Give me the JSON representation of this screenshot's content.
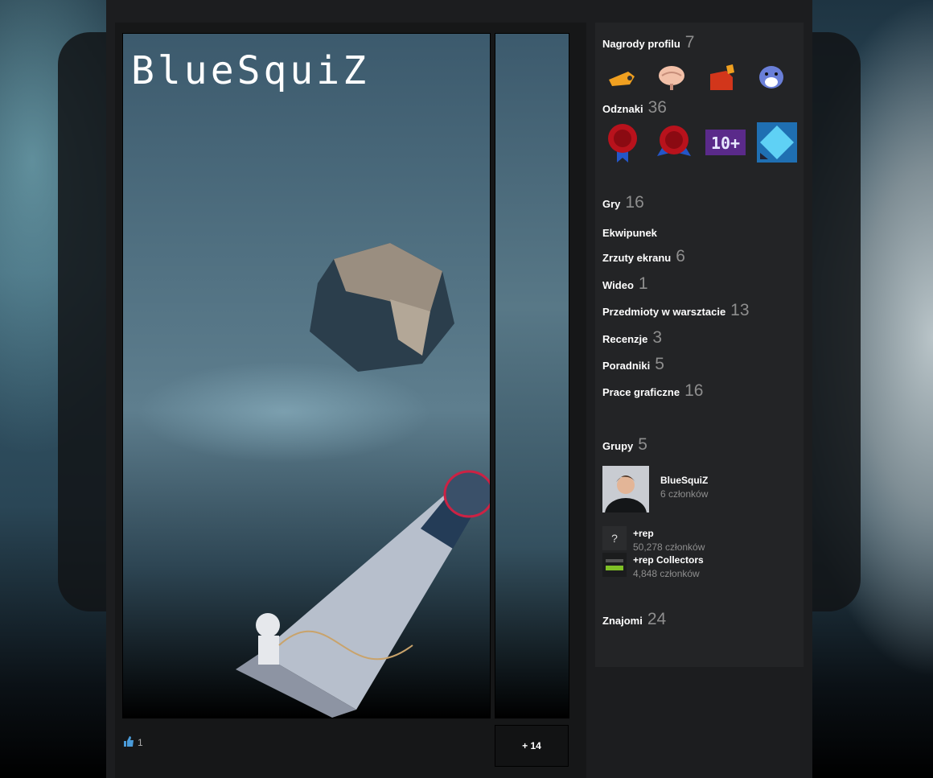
{
  "showcase": {
    "title": "BlueSquiZ",
    "likes": "1",
    "more_label": "+ 14"
  },
  "rewards": {
    "label": "Nagrody profilu",
    "count": "7",
    "icons": [
      "whistle-icon",
      "brain-icon",
      "fuel-can-icon",
      "leopard-icon"
    ]
  },
  "badges": {
    "label": "Odznaki",
    "count": "36",
    "icons": [
      "wax-seal-badge-icon",
      "wax-seal-badge-icon",
      "ten-plus-badge-icon",
      "crystal-badge-icon"
    ],
    "ten_plus_text": "10+"
  },
  "links": [
    {
      "label": "Gry",
      "count": "16"
    },
    {
      "label": "Ekwipunek",
      "count": ""
    },
    {
      "label": "Zrzuty ekranu",
      "count": "6"
    },
    {
      "label": "Wideo",
      "count": "1"
    },
    {
      "label": "Przedmioty w warsztacie",
      "count": "13"
    },
    {
      "label": "Recenzje",
      "count": "3"
    },
    {
      "label": "Poradniki",
      "count": "5"
    },
    {
      "label": "Prace graficzne",
      "count": "16"
    }
  ],
  "groups": {
    "label": "Grupy",
    "count": "5",
    "featured": {
      "name": "BlueSquiZ",
      "members": "6 członków"
    },
    "items": [
      {
        "name": "+rep",
        "members": "50,278 członków",
        "icon": "?"
      },
      {
        "name": "+rep Collectors",
        "members": "4,848 członków",
        "icon": ""
      }
    ]
  },
  "friends": {
    "label": "Znajomi",
    "count": "24"
  },
  "colors": {
    "page_bg": "#1c1d1f",
    "sidebar_bg": "#232426",
    "count_gray": "#8e8e8e",
    "like_blue": "#4a9bd9"
  }
}
